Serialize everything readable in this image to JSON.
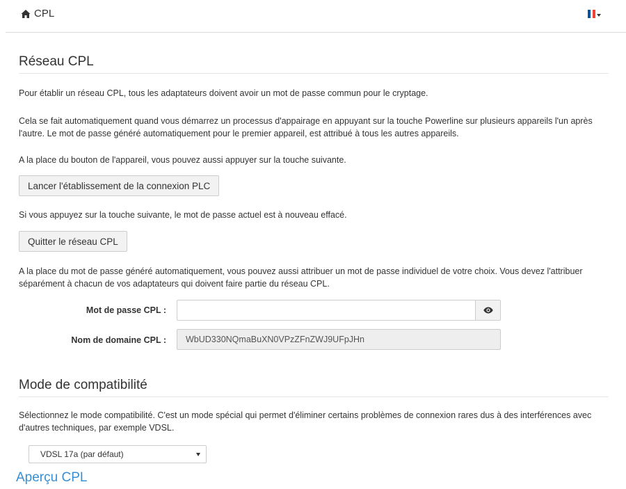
{
  "header": {
    "title": "CPL",
    "home_icon": "home-icon",
    "language_flag": "french-flag-icon",
    "flag_colors": [
      "#0055a4",
      "#ffffff",
      "#ef4135"
    ]
  },
  "cpl_network": {
    "title": "Réseau CPL",
    "intro": "Pour établir un réseau CPL, tous les adaptateurs doivent avoir un mot de passe commun pour le cryptage.",
    "auto_pairing": "Cela se fait automatiquement quand vous démarrez un processus d'appairage en appuyant sur la touche Powerline sur plusieurs appareils l'un après l'autre. Le mot de passe généré automatiquement pour le premier appareil, est attribué à tous les autres appareils.",
    "alternative": "A la place du bouton de l'appareil, vous pouvez aussi appuyer sur la touche suivante.",
    "start_button": "Lancer l'établissement de la connexion PLC",
    "reset_info": "Si vous appuyez sur la touche suivante, le mot de passe actuel est à nouveau effacé.",
    "leave_button": "Quitter le réseau CPL",
    "custom_password_info": "A la place du mot de passe généré automatiquement, vous pouvez aussi attribuer un mot de passe individuel de votre choix. Vous devez l'attribuer séparément à chacun de vos adaptateurs qui doivent faire partie du réseau CPL.",
    "password_label": "Mot de passe CPL :",
    "password_value": "",
    "password_toggle_icon": "eye-icon",
    "domain_label": "Nom de domaine CPL :",
    "domain_value": "WbUD330NQmaBuXN0VPzZFnZWJ9UFpJHn"
  },
  "compatibility": {
    "title": "Mode de compatibilité",
    "description": "Sélectionnez le mode compatibilité. C'est un mode spécial qui permet d'éliminer certains problèmes de connexion rares dus à des interférences avec d'autres techniques, par exemple VDSL.",
    "selected_mode": "VDSL 17a (par défaut)"
  },
  "footer_link": "Aperçu CPL",
  "colors": {
    "link": "#3a8fd1"
  }
}
